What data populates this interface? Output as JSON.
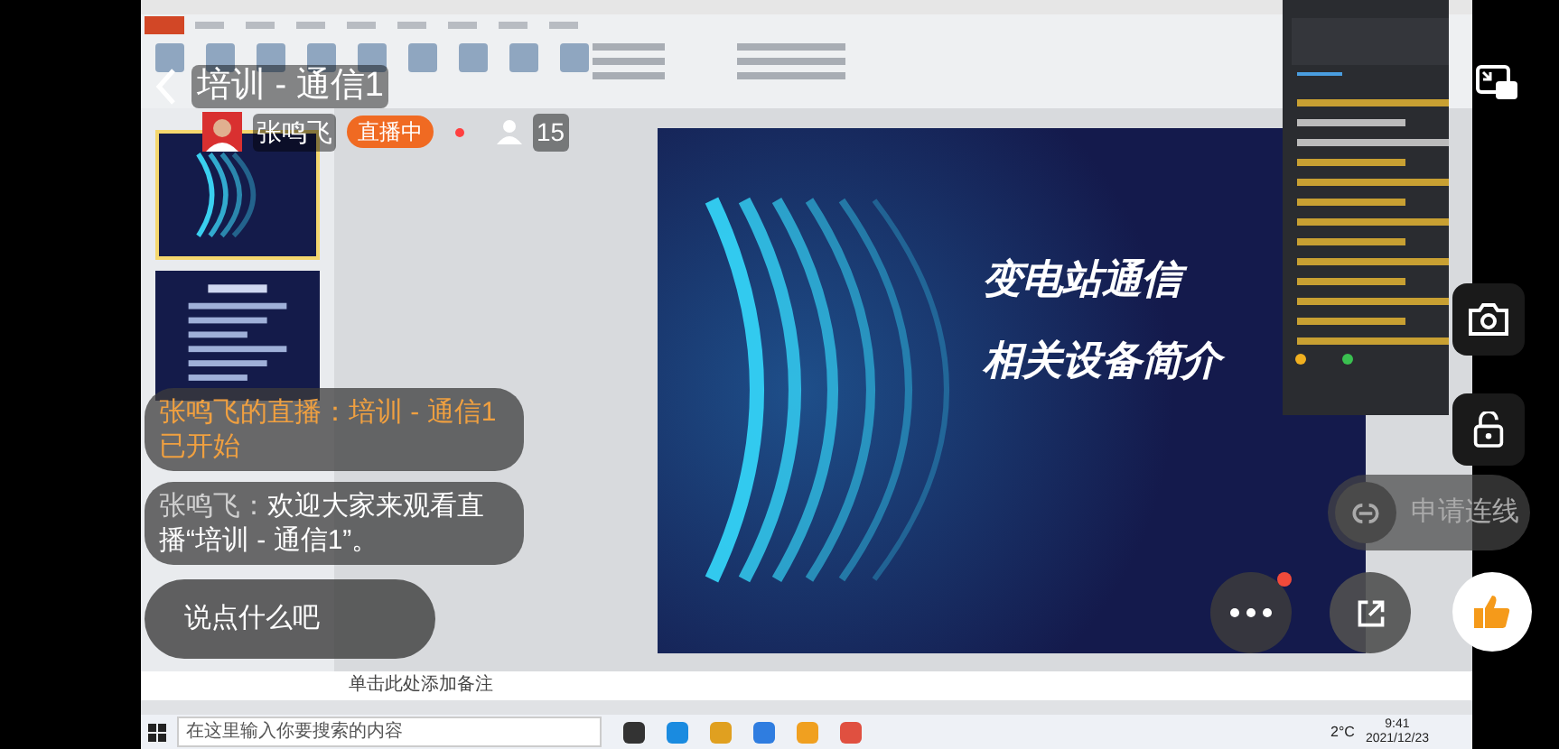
{
  "header": {
    "title": "培训 - 通信1"
  },
  "host": {
    "name": "张鸣飞",
    "status": "直播中",
    "viewers": "15"
  },
  "shared_screen": {
    "thumbnails": [
      {
        "selected": true
      },
      {
        "selected": false
      }
    ],
    "slide": {
      "title_lines": [
        "变电站通信",
        "相关设备简介"
      ]
    },
    "notes_text": "单击此处添加备注",
    "taskbar": {
      "search_placeholder": "在这里输入你要搜索的内容",
      "temperature": "2°C",
      "time": "9:41",
      "date": "2021/12/23"
    }
  },
  "messages": [
    {
      "kind": "system",
      "text": "张鸣飞的直播：培训 - 通信1已开始"
    },
    {
      "kind": "user",
      "author": "张鸣飞：",
      "text": "欢迎大家来观看直播“培训 - 通信1”。"
    }
  ],
  "comment_field": {
    "placeholder": "说点什么吧"
  },
  "connect_button": {
    "label": "申请连线"
  },
  "more_button": {
    "notification": true
  }
}
